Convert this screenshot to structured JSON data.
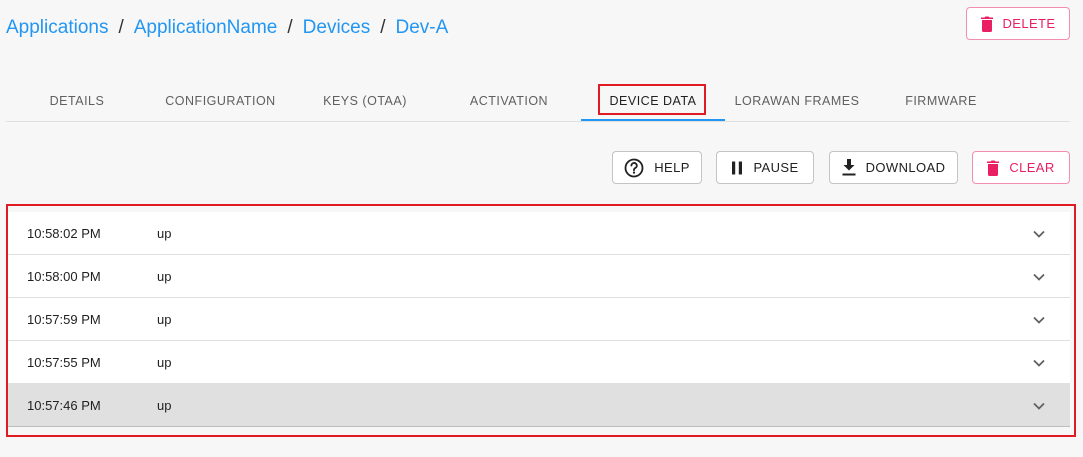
{
  "breadcrumb": {
    "items": [
      "Applications",
      "ApplicationName",
      "Devices",
      "Dev-A"
    ],
    "separator": "/"
  },
  "header": {
    "delete_label": "DELETE"
  },
  "tabs": [
    {
      "label": "DETAILS"
    },
    {
      "label": "CONFIGURATION"
    },
    {
      "label": "KEYS (OTAA)"
    },
    {
      "label": "ACTIVATION"
    },
    {
      "label": "DEVICE DATA",
      "active": true
    },
    {
      "label": "LORAWAN FRAMES"
    },
    {
      "label": "FIRMWARE"
    }
  ],
  "toolbar": {
    "help_label": "HELP",
    "pause_label": "PAUSE",
    "download_label": "DOWNLOAD",
    "clear_label": "CLEAR"
  },
  "frames": [
    {
      "time": "10:58:02 PM",
      "type": "up"
    },
    {
      "time": "10:58:00 PM",
      "type": "up"
    },
    {
      "time": "10:57:59 PM",
      "type": "up"
    },
    {
      "time": "10:57:55 PM",
      "type": "up"
    },
    {
      "time": "10:57:46 PM",
      "type": "up",
      "selected": true
    }
  ],
  "colors": {
    "link": "#2196f3",
    "accent_pink": "#e91e63",
    "annotation_red": "#e01b24"
  },
  "icons": {
    "delete": "trash-icon",
    "help": "help-circle-icon",
    "pause": "pause-icon",
    "download": "download-icon",
    "clear": "trash-icon",
    "expand": "chevron-down-icon"
  }
}
